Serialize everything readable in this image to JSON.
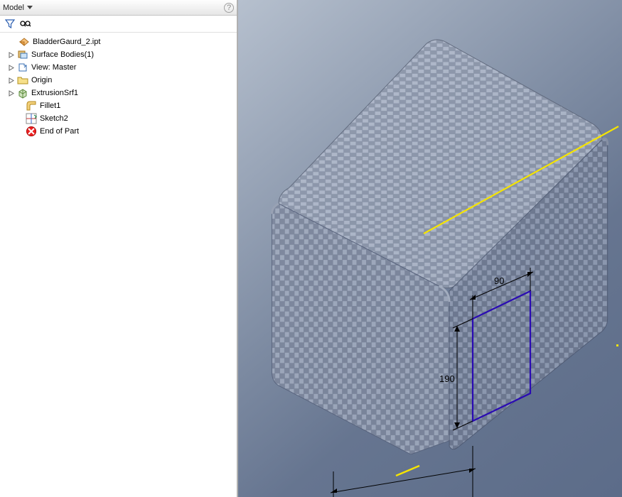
{
  "browser": {
    "title": "Model",
    "help_tooltip": "?"
  },
  "toolbar": {
    "filter_icon": "filter",
    "find_icon": "find"
  },
  "tree": {
    "root": {
      "label": "BladderGaurd_2.ipt"
    },
    "surface_bodies": {
      "label": "Surface Bodies(1)"
    },
    "view": {
      "label": "View: Master"
    },
    "origin": {
      "label": "Origin"
    },
    "extrusion": {
      "label": "ExtrusionSrf1"
    },
    "fillet": {
      "label": "Fillet1"
    },
    "sketch": {
      "label": "Sketch2"
    },
    "end_of_part": {
      "label": "End of Part"
    }
  },
  "viewport": {
    "dimensions": {
      "width_value": "90",
      "height_value": "190"
    }
  }
}
